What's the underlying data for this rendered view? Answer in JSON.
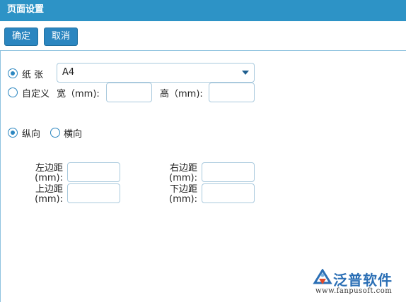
{
  "window": {
    "title": "页面设置"
  },
  "toolbar": {
    "ok_label": "确定",
    "cancel_label": "取消"
  },
  "paper": {
    "label": "纸 张",
    "selected": "A4",
    "custom_label": "自定义",
    "width_label": "宽（mm):",
    "height_label": "高（mm):",
    "paper_checked": true
  },
  "orientation": {
    "portrait_label": "纵向",
    "landscape_label": "横向",
    "portrait_checked": true
  },
  "margins": {
    "left_label": "左边距(mm):",
    "right_label": "右边距(mm):",
    "top_label": "上边距(mm):",
    "bottom_label": "下边距(mm):"
  },
  "logo": {
    "name": "泛普软件",
    "url": "www.fanpusoft.com",
    "color": "#2b6fb5"
  },
  "colors": {
    "titlebar": "#2d93c6",
    "button": "#2b86c0",
    "border": "#a9c9dd"
  }
}
